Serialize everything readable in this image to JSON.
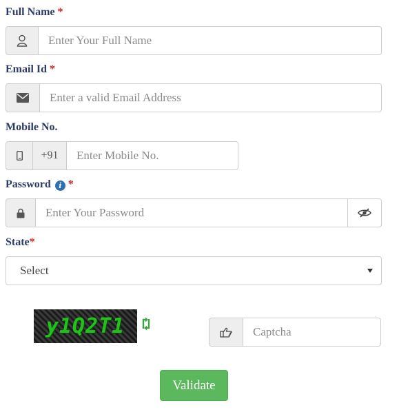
{
  "form": {
    "full_name": {
      "label": "Full Name",
      "required_mark": "*",
      "icon": "user-icon",
      "placeholder": "Enter Your Full Name",
      "value": ""
    },
    "email": {
      "label": "Email Id",
      "required_mark": "*",
      "icon": "envelope-icon",
      "placeholder": "Enter a valid Email Address",
      "value": ""
    },
    "mobile": {
      "label": "Mobile No.",
      "icon": "mobile-phone-icon",
      "country_code": "+91",
      "placeholder": "Enter Mobile No.",
      "value": ""
    },
    "password": {
      "label": "Password",
      "info_icon": "info-circle-icon",
      "required_mark": "*",
      "icon": "lock-icon",
      "toggle_icon": "eye-slash-icon",
      "placeholder": "Enter Your Password",
      "value": ""
    },
    "state": {
      "label": "State",
      "required_mark": "*",
      "selected": "Select"
    },
    "captcha": {
      "image_text": "y1Q2T1",
      "refresh_icon": "refresh-icon",
      "hand_icon": "hand-pointer-icon",
      "placeholder": "Captcha",
      "value": ""
    },
    "submit_label": "Validate"
  },
  "colors": {
    "label": "#2b3a67",
    "required": "#c62828",
    "addon_bg": "#eeeeee",
    "border": "#cccccc",
    "button": "#5cb85c",
    "captcha_text": "#22c21c",
    "refresh": "#3aa53a",
    "info": "#2f6fb3"
  }
}
